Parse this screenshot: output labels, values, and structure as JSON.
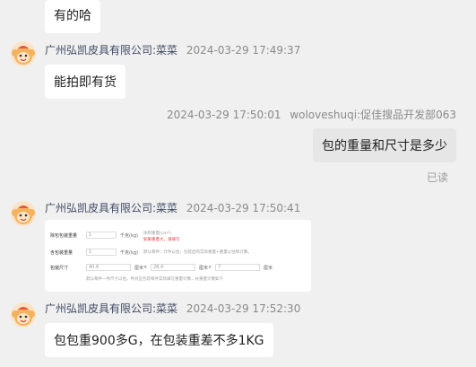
{
  "messages": {
    "m0": {
      "text": "有的哈"
    },
    "m1": {
      "sender": "广州弘凯皮具有限公司:菜菜",
      "time": "2024-03-29 17:49:37",
      "text": "能拍即有货"
    },
    "m2": {
      "sender": "woloveshuqi:促佳搜品开发部063",
      "time": "2024-03-29 17:50:01",
      "text": "包的重量和尺寸是多少",
      "status": "已读"
    },
    "m3": {
      "sender": "广州弘凯皮具有限公司:菜菜",
      "time": "2024-03-29 17:50:41",
      "image": {
        "row1_label": "除包包装重量",
        "row1_value": "1",
        "row1_unit": "千克(kg)",
        "row1_hint_a": "体积重量(cm³)：",
        "row1_hint_b": "如果重量大，请填写",
        "row2_label": "含包装重量",
        "row2_value": "1",
        "row2_unit": "千克(kg)",
        "row2_hint": "默认每件：计件以估，包装后的实际重量+重量以估和计算。",
        "row3_label": "包装尺寸",
        "row3_l": "40.6",
        "row3_w": "28.4",
        "row3_h": "7",
        "row3_unit": "厘米",
        "footer_hint": "默认每件一件尺寸以估，件对应包装每件实际填写重量计算，长重量计算如下"
      }
    },
    "m4": {
      "sender": "广州弘凯皮具有限公司:菜菜",
      "time": "2024-03-29 17:52:30",
      "text": "包包重900多G，在包装重差不多1KG"
    }
  },
  "colors": {
    "background": "#f0f0f0",
    "bubble_other": "#ffffff",
    "bubble_self": "#e6e6e6",
    "sender": "#3f4a63",
    "meta": "#8a8a8a"
  },
  "icons": {
    "avatar": "monkey-avatar-icon"
  }
}
